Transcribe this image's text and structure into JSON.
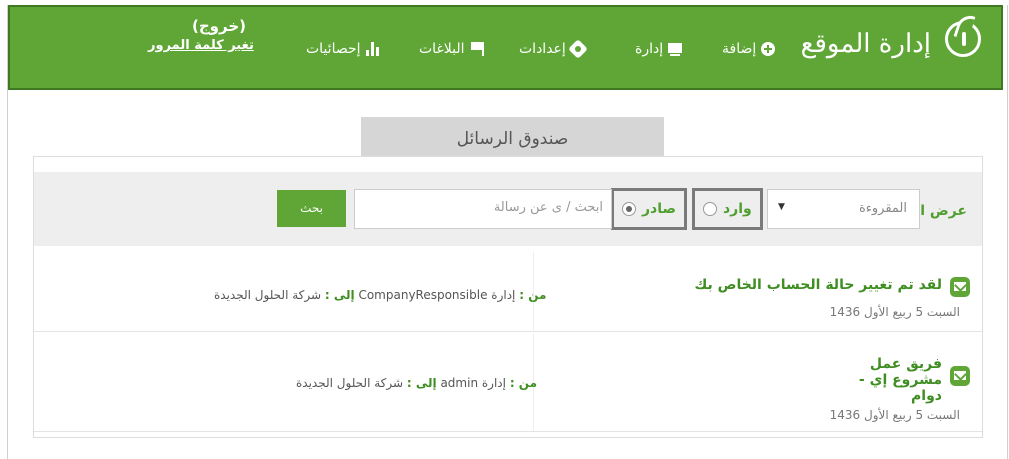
{
  "header": {
    "brand": "إدارة الموقع",
    "nav": {
      "add": "إضافة",
      "manage": "إدارة",
      "settings": "إعدادات",
      "reports": "البلاغات",
      "stats": "إحصائيات"
    },
    "logout": "(خروج)",
    "change_password": "تغير كلمة المرور"
  },
  "tab": {
    "label": "صندوق الرسائل"
  },
  "filter": {
    "label": "عرض الرسائل :",
    "select_value": "المقروءة",
    "radio_inbox": "وارد",
    "radio_outbox": "صادر",
    "selected": "صادر",
    "search_placeholder": "ابحث / ى عن رسالة",
    "search_button": "بحث"
  },
  "messages": [
    {
      "subject": "لقد تم تغيير حالة الحساب الخاص بك",
      "date": "السبت 5 ربيع الأول 1436",
      "from_label": "من :",
      "from": "إدارة CompanyResponsible",
      "to_label": "إلى :",
      "to": "شركة الحلول الجديدة"
    },
    {
      "subject": "فريق عمل مشروع إي - دوام",
      "date": "السبت 5 ربيع الأول 1436",
      "from_label": "من :",
      "from": "إدارة admin",
      "to_label": "إلى :",
      "to": "شركة الحلول الجديدة"
    }
  ],
  "colors": {
    "accent": "#5fa636",
    "text_green": "#3f8e22"
  }
}
